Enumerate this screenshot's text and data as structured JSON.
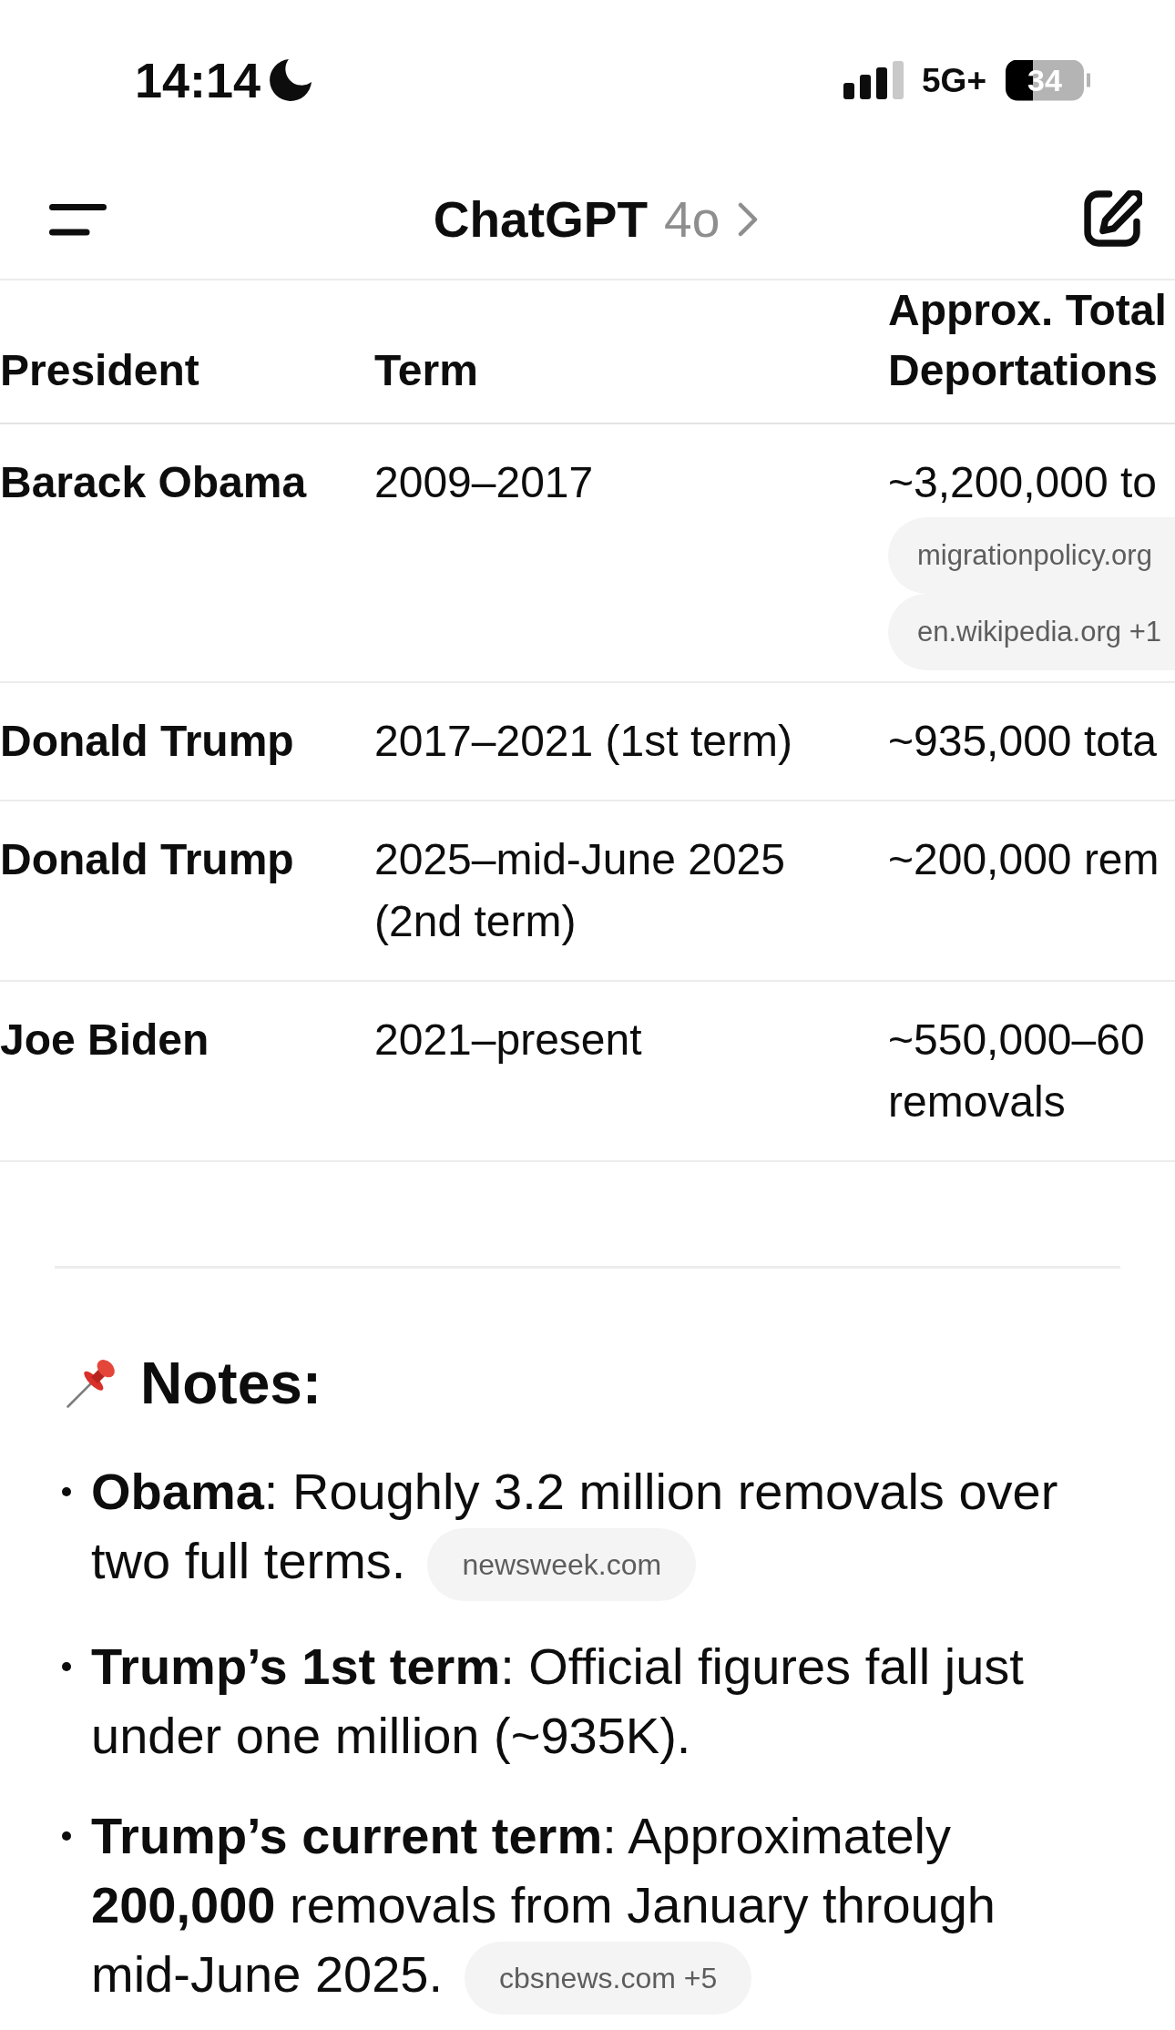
{
  "status_bar": {
    "time": "14:14",
    "network": "5G+",
    "battery": "34"
  },
  "header": {
    "title": "ChatGPT",
    "model": "4o"
  },
  "table": {
    "columns": [
      "President",
      "Term",
      "Approx. Total Deportations"
    ],
    "rows": [
      {
        "cells": [
          {
            "text": "Barack Obama"
          },
          {
            "text": "2009–2017"
          },
          {
            "text": "~3,200,000 to",
            "sources": [
              "migrationpolicy.org",
              "en.wikipedia.org +1"
            ]
          }
        ]
      },
      {
        "cells": [
          {
            "text": "Donald Trump"
          },
          {
            "text": "2017–2021 (1st term)"
          },
          {
            "text": "~935,000 tota"
          }
        ]
      },
      {
        "cells": [
          {
            "text": "Donald Trump"
          },
          {
            "text": "2025–mid-June 2025 (2nd term)"
          },
          {
            "text": "~200,000 rem"
          }
        ]
      },
      {
        "cells": [
          {
            "text": "Joe Biden"
          },
          {
            "text": "2021–present"
          },
          {
            "text": "~550,000–60 removals"
          }
        ]
      }
    ]
  },
  "notes": {
    "heading": "Notes:",
    "items": [
      {
        "text": "**Obama**: Roughly 3.2 million removals over two full terms.",
        "source": "newsweek.com"
      },
      {
        "text": "**Trump’s 1st term**: Official figures fall just under one million (~935K)."
      },
      {
        "text": "**Trump’s current term**: Approximately **200,000** removals from January through mid-June 2025.",
        "source": "cbsnews.com +5"
      }
    ]
  }
}
